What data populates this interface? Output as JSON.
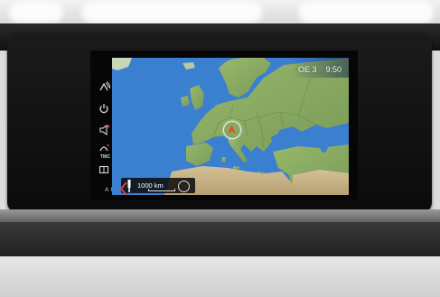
{
  "status_bar": {
    "radio_station": "OE 3",
    "clock": "9:50"
  },
  "sidebar": {
    "icons": [
      "satellite-signal-icon",
      "power-icon",
      "speaker-icon",
      "tmc-traffic-icon",
      "map-book-icon"
    ],
    "tmc_label": "TMC",
    "an_label": "A N"
  },
  "map": {
    "scale_label": "1000 km",
    "region": "Europe"
  },
  "colors": {
    "sea": "#3a7fd0",
    "land": "#8aab62",
    "desert": "#c9b48a",
    "vehicle": "#e5502a"
  }
}
